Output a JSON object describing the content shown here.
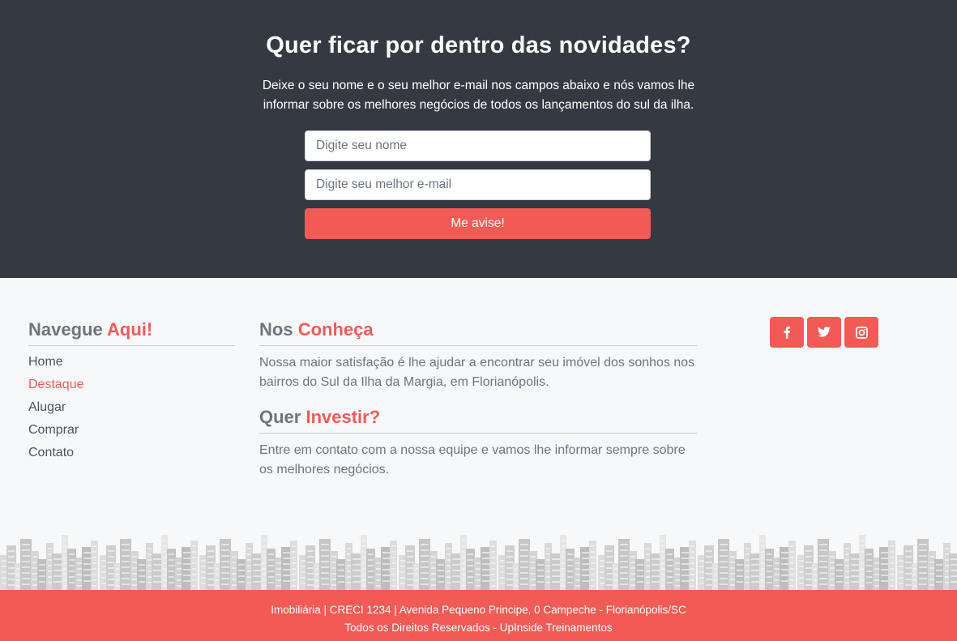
{
  "newsletter": {
    "title": "Quer ficar por dentro das novidades?",
    "description": "Deixe o seu nome e o seu melhor e-mail nos campos abaixo e nós vamos lhe informar sobre os melhores negócios de todos os lançamentos do sul da ilha.",
    "name_placeholder": "Digite seu nome",
    "email_placeholder": "Digite seu melhor e-mail",
    "submit_label": "Me avise!"
  },
  "navigate": {
    "title_plain": "Navegue ",
    "title_accent": "Aqui!",
    "links": [
      "Home",
      "Destaque",
      "Alugar",
      "Comprar",
      "Contato"
    ],
    "active_link": "Destaque"
  },
  "about": {
    "title_plain": "Nos ",
    "title_accent": "Conheça",
    "text": "Nossa maior satisfação é lhe ajudar a encontrar seu imóvel dos sonhos nos bairros do Sul da Ilha da Margia, em Florianópolis."
  },
  "invest": {
    "title_plain": "Quer ",
    "title_accent": "Investir?",
    "text": "Entre em contato com a nossa equipe e vamos lhe informar sempre sobre os melhores negócios."
  },
  "social": [
    "facebook-icon",
    "twitter-icon",
    "instagram-icon"
  ],
  "footer": {
    "line1": "Imobiliária | CRECI 1234 | Avenida Pequeno Principe, 0 Campeche - Florianópolis/SC",
    "line2": "Todos os Direitos Reservados - UpInside Treinamentos"
  },
  "colors": {
    "accent": "#f25a55",
    "dark_bg": "#353a42",
    "light_bg": "#f7f8fa"
  }
}
